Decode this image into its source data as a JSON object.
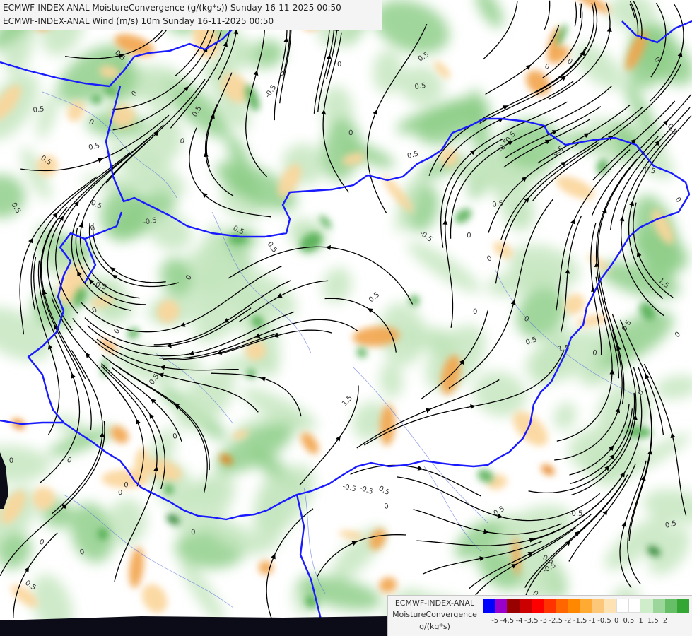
{
  "map": {
    "title_line_1": "ECMWF-INDEX-ANAL MoistureConvergence (g/(kg*s)) Sunday 16-11-2025 00:50",
    "title_line_2": "ECMWF-INDEX-ANAL Wind (m/s) 10m Sunday 16-11-2025 00:50",
    "contour_label_values": [
      "0",
      "0.5",
      "-0.5",
      "1.5"
    ],
    "colors": {
      "background": "#ffffff",
      "convergence_light": "#c6e6c0",
      "convergence_mid": "#8fcf8a",
      "convergence_strong": "#44a845",
      "divergence_light": "#fbd59a",
      "divergence_mid": "#f2a44a",
      "border_line": "#1a1aff",
      "streamline": "#000000"
    }
  },
  "legend": {
    "label_line_1": "ECMWF-INDEX-ANAL",
    "label_line_2": "MoistureConvergence",
    "label_line_3": "g/(kg*s)",
    "colors": [
      "#0000ff",
      "#9900cc",
      "#990000",
      "#cc0000",
      "#ff0000",
      "#ff3300",
      "#ff6600",
      "#ff8800",
      "#ffaa33",
      "#fdc77a",
      "#fde3b4",
      "#ffffff",
      "#ffffff",
      "#cfeccb",
      "#9cd69a",
      "#66bf66",
      "#33a633"
    ],
    "tick_labels": [
      "-5",
      "-4.5",
      "-4",
      "-3.5",
      "-3",
      "-2.5",
      "-2",
      "-1.5",
      "-1",
      "-0.5",
      "0",
      "0.5",
      "1",
      "1.5",
      "2"
    ]
  }
}
